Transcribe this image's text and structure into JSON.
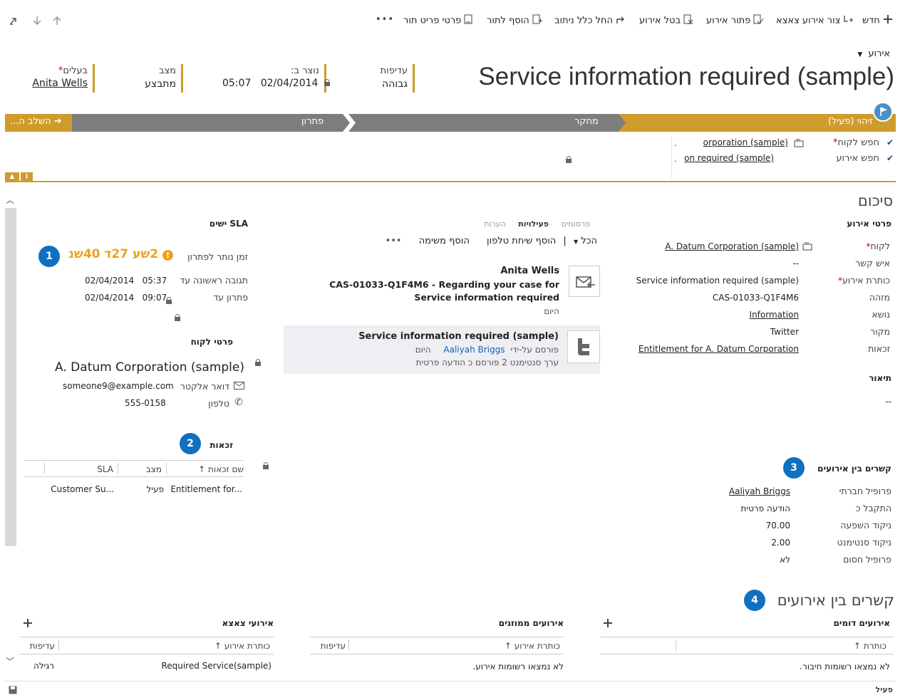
{
  "toolbar": {
    "new": "חדש",
    "create_child": "צור אירוע צאצא",
    "resolve": "פתור אירוע",
    "cancel": "בטל אירוע",
    "apply_routing": "החל כלל ניתוב",
    "add_to_queue": "הוסף לתור",
    "queue_item_details": "פרטי פריט תור",
    "more": "•••"
  },
  "header": {
    "entity": "אירוע",
    "title": "Service information required (sample)",
    "priority_label": "עדיפות",
    "priority_value": "גבוהה",
    "created_label": "נוצר ב:",
    "created_date": "02/04/2014",
    "created_time": "05:07",
    "status_label": "מצב",
    "status_value": "מתבצע",
    "owner_label": "בעלים",
    "owner_required": "*",
    "owner_value": "Anita Wells"
  },
  "process": {
    "stage_identify": "זיהוי (פעיל)",
    "stage_research": "מחקר",
    "stage_resolve": "פתרון",
    "next_stage": "השלב ה..."
  },
  "stage_steps": [
    {
      "label": "חפש לקוח",
      "required": "*",
      "value": "orporation (sample)",
      "prefix": "."
    },
    {
      "label": "חפש אירוע",
      "required": "",
      "value": "on required (sample)",
      "prefix": "."
    }
  ],
  "summary": {
    "title": "סיכום",
    "case_details_title": "פרטי אירוע",
    "fields": [
      {
        "label": "לקוח",
        "required": "*",
        "value": "A. Datum Corporation (sample)"
      },
      {
        "label": "איש קשר",
        "required": "",
        "value": "--"
      },
      {
        "label": "כותרת אירוע",
        "required": "*",
        "value": "Service information required (sample)"
      },
      {
        "label": "מזהה",
        "required": "",
        "value": "CAS-01033-Q1F4M6"
      },
      {
        "label": "נושא",
        "required": "",
        "value": "Information"
      },
      {
        "label": "מקור",
        "required": "",
        "value": "Twitter"
      },
      {
        "label": "זכאות",
        "required": "",
        "value": "Entitlement for A. Datum Corporation"
      }
    ],
    "description_title": "תיאור",
    "description_value": "--",
    "relations_title": "קשרים בין אירועים",
    "relation_fields": [
      {
        "label": "פרופיל חברתי",
        "value": "Aaliyah Briggs"
      },
      {
        "label": "התקבל כ",
        "value": "הודעה פרטית"
      },
      {
        "label": "ניקוד השפעה",
        "value": "70.00"
      },
      {
        "label": "ניקוד סנטימנט",
        "value": "2.00"
      },
      {
        "label": "פרופיל חסום",
        "value": "לא"
      }
    ]
  },
  "activities": {
    "tab_posts": "פרסומים",
    "tab_activities": "פעילויות",
    "tab_notes": "הערות",
    "filter_all": "הכל",
    "add_phone": "הוסף שיחת טלפון",
    "add_task": "הוסף משימה",
    "more": "•••",
    "items": [
      {
        "from": "Anita Wells",
        "subject": "CAS-01033-Q1F4M6 - Regarding your case for Service information required",
        "date": "היום"
      },
      {
        "title": "Service information required (sample)",
        "posted_by_label": "פורסם על-ידי",
        "posted_by": "Aaliyah Briggs",
        "date": "היום",
        "sentiment": "ערך סנטימנט 2 פורסם כ הודעה פרטית"
      }
    ]
  },
  "sla": {
    "title": "SLA ישים",
    "remaining_label": "זמן נותר לפתרון",
    "remaining_value": "2שע 27ד 40שנ",
    "first_response_label": "תגובה ראשונה עד",
    "first_response_date": "02/04/2014",
    "first_response_time": "05:37",
    "resolve_by_label": "פתרון עד",
    "resolve_by_date": "02/04/2014",
    "resolve_by_time": "09:07"
  },
  "customer": {
    "title": "פרטי לקוח",
    "name": "A. Datum Corporation (sample)",
    "email_label": "דואר אלקטר",
    "email": "someone9@example.com",
    "phone_label": "טלפון",
    "phone": "555-0158"
  },
  "entitlements": {
    "title": "זכאות",
    "col_name": "שם זכאות",
    "col_status": "מצב",
    "col_sla": "SLA",
    "rows": [
      {
        "name": "Entitlement for...",
        "status": "פעיל",
        "sla": "Customer Su..."
      }
    ]
  },
  "bottom": {
    "title": "קשרים בין אירועים",
    "similar_title": "אירועים דומים",
    "similar_col": "כותרת",
    "similar_empty": "לא נמצאו רשומות חיבור.",
    "merged_title": "אירועים ממוזגים",
    "merged_col_title": "כותרת אירוע",
    "merged_col_priority": "עדיפות",
    "merged_empty": "לא נמצאו רשומות אירוע.",
    "child_title": "אירועי צאצא",
    "child_col_title": "כותרת אירוע",
    "child_col_priority": "עדיפות",
    "child_rows": [
      {
        "title": "Required Service(sample)",
        "priority": "רגילה"
      }
    ]
  },
  "badges": [
    "1",
    "2",
    "3",
    "4"
  ],
  "footer": {
    "status": "פעיל"
  },
  "colors": {
    "accent": "#cf9b2d",
    "stage_gray": "#7a7a7a",
    "badge_blue": "#1070c0",
    "sla_orange": "#f0a01e"
  }
}
